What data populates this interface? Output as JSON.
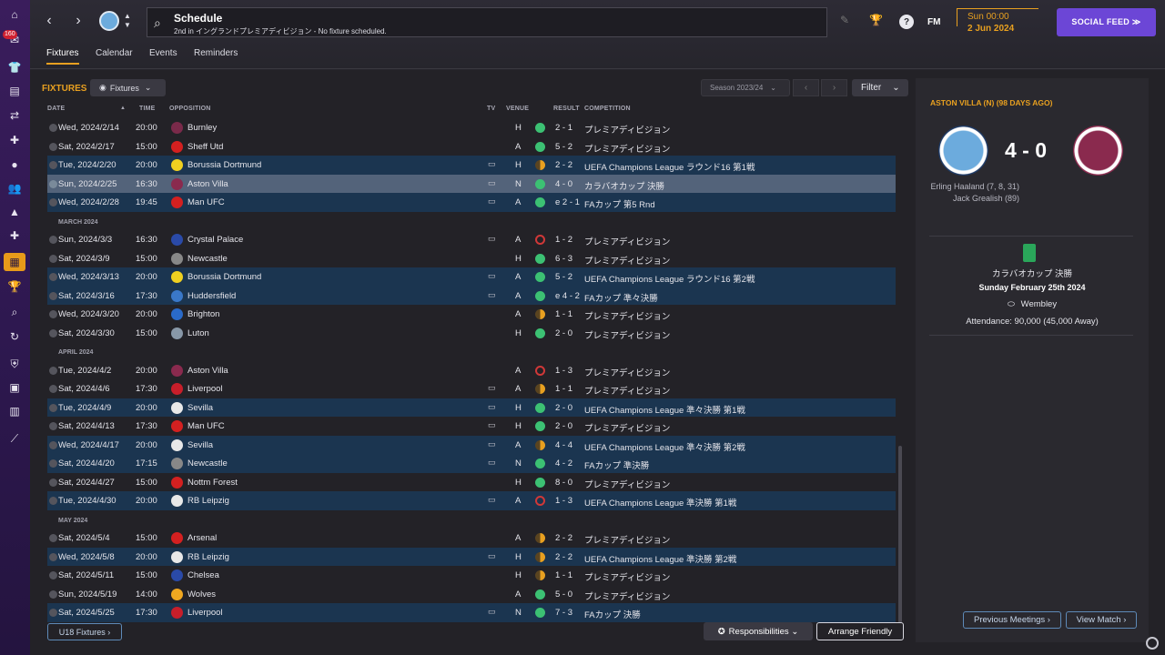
{
  "header": {
    "title": "Schedule",
    "subtitle": "2nd in イングランドプレミアディビジョン - No fixture scheduled.",
    "fm_logo": "FM",
    "time": "Sun 00:00",
    "date": "2 Jun 2024",
    "social_feed_label": "SOCIAL FEED ≫"
  },
  "sidebar": {
    "badge_count": "160",
    "icons": [
      "home-icon",
      "inbox-icon",
      "squad-icon",
      "clipboard-icon",
      "transfer-icon",
      "medical-icon",
      "ball-icon",
      "staff-icon",
      "tactics-icon",
      "training-icon",
      "schedule-icon",
      "trophy-icon",
      "search-icon",
      "refresh-icon",
      "shield-icon",
      "finance-icon",
      "ticket-icon",
      "graph-icon"
    ]
  },
  "tabs": [
    "Fixtures",
    "Calendar",
    "Events",
    "Reminders"
  ],
  "toolbar": {
    "heading": "FIXTURES",
    "fixtures_dropdown": "Fixtures",
    "season_dropdown": "Season 2023/24",
    "filter_label": "Filter"
  },
  "columns": {
    "date": "DATE",
    "time": "TIME",
    "opposition": "OPPOSITION",
    "tv": "TV",
    "venue": "VENUE",
    "result": "RESULT",
    "competition": "COMPETITION"
  },
  "colors": {
    "accent": "#e8a020",
    "win": "#3cc173",
    "loss": "#d03838",
    "draw": "#e8a020",
    "social": "#6c46d6"
  },
  "fixtures": [
    {
      "kind": "match",
      "style": "norm",
      "date": "Wed, 2024/2/14",
      "time": "20:00",
      "opp": "Burnley",
      "color": "#7a2a4a",
      "tv": "",
      "venue": "H",
      "result": "w",
      "score": "2 - 1",
      "comp": "プレミアディビジョン"
    },
    {
      "kind": "match",
      "style": "norm",
      "date": "Sat, 2024/2/17",
      "time": "15:00",
      "opp": "Sheff Utd",
      "color": "#d42020",
      "tv": "",
      "venue": "A",
      "result": "w",
      "score": "5 - 2",
      "comp": "プレミアディビジョン"
    },
    {
      "kind": "match",
      "style": "alt",
      "date": "Tue, 2024/2/20",
      "time": "20:00",
      "opp": "Borussia Dortmund",
      "color": "#f0d020",
      "tv": "▭",
      "venue": "H",
      "result": "d",
      "score": "2 - 2",
      "comp": "UEFA Champions League ラウンド16 第1戦"
    },
    {
      "kind": "match",
      "style": "sel",
      "date": "Sun, 2024/2/25",
      "time": "16:30",
      "opp": "Aston Villa",
      "color": "#8a2a4e",
      "tv": "▭",
      "venue": "N",
      "result": "w",
      "score": "4 - 0",
      "comp": "カラバオカップ 決勝"
    },
    {
      "kind": "match",
      "style": "alt",
      "date": "Wed, 2024/2/28",
      "time": "19:45",
      "opp": "Man UFC",
      "color": "#d42020",
      "tv": "▭",
      "venue": "A",
      "result": "w",
      "score": "e 2 - 1",
      "comp": "FAカップ 第5 Rnd"
    },
    {
      "kind": "month",
      "label": "MARCH 2024"
    },
    {
      "kind": "match",
      "style": "norm",
      "date": "Sun, 2024/3/3",
      "time": "16:30",
      "opp": "Crystal Palace",
      "color": "#2a4aa8",
      "tv": "▭",
      "venue": "A",
      "result": "l",
      "score": "1 - 2",
      "comp": "プレミアディビジョン"
    },
    {
      "kind": "match",
      "style": "norm",
      "date": "Sat, 2024/3/9",
      "time": "15:00",
      "opp": "Newcastle",
      "color": "#888888",
      "tv": "",
      "venue": "H",
      "result": "w",
      "score": "6 - 3",
      "comp": "プレミアディビジョン"
    },
    {
      "kind": "match",
      "style": "alt",
      "date": "Wed, 2024/3/13",
      "time": "20:00",
      "opp": "Borussia Dortmund",
      "color": "#f0d020",
      "tv": "▭",
      "venue": "A",
      "result": "w",
      "score": "5 - 2",
      "comp": "UEFA Champions League ラウンド16 第2戦"
    },
    {
      "kind": "match",
      "style": "alt",
      "date": "Sat, 2024/3/16",
      "time": "17:30",
      "opp": "Huddersfield",
      "color": "#3a78c8",
      "tv": "▭",
      "venue": "A",
      "result": "w",
      "score": "e 4 - 2",
      "comp": "FAカップ 準々決勝"
    },
    {
      "kind": "match",
      "style": "norm",
      "date": "Wed, 2024/3/20",
      "time": "20:00",
      "opp": "Brighton",
      "color": "#2a6ac8",
      "tv": "",
      "venue": "A",
      "result": "d",
      "score": "1 - 1",
      "comp": "プレミアディビジョン"
    },
    {
      "kind": "match",
      "style": "norm",
      "date": "Sat, 2024/3/30",
      "time": "15:00",
      "opp": "Luton",
      "color": "#8898a8",
      "tv": "",
      "venue": "H",
      "result": "w",
      "score": "2 - 0",
      "comp": "プレミアディビジョン"
    },
    {
      "kind": "month",
      "label": "APRIL 2024"
    },
    {
      "kind": "match",
      "style": "norm",
      "date": "Tue, 2024/4/2",
      "time": "20:00",
      "opp": "Aston Villa",
      "color": "#8a2a4e",
      "tv": "",
      "venue": "A",
      "result": "l",
      "score": "1 - 3",
      "comp": "プレミアディビジョン"
    },
    {
      "kind": "match",
      "style": "norm",
      "date": "Sat, 2024/4/6",
      "time": "17:30",
      "opp": "Liverpool",
      "color": "#c81e2a",
      "tv": "▭",
      "venue": "A",
      "result": "d",
      "score": "1 - 1",
      "comp": "プレミアディビジョン"
    },
    {
      "kind": "match",
      "style": "alt",
      "date": "Tue, 2024/4/9",
      "time": "20:00",
      "opp": "Sevilla",
      "color": "#e8e8e8",
      "tv": "▭",
      "venue": "H",
      "result": "w",
      "score": "2 - 0",
      "comp": "UEFA Champions League 準々決勝 第1戦"
    },
    {
      "kind": "match",
      "style": "norm",
      "date": "Sat, 2024/4/13",
      "time": "17:30",
      "opp": "Man UFC",
      "color": "#d42020",
      "tv": "▭",
      "venue": "H",
      "result": "w",
      "score": "2 - 0",
      "comp": "プレミアディビジョン"
    },
    {
      "kind": "match",
      "style": "alt",
      "date": "Wed, 2024/4/17",
      "time": "20:00",
      "opp": "Sevilla",
      "color": "#e8e8e8",
      "tv": "▭",
      "venue": "A",
      "result": "d",
      "score": "4 - 4",
      "comp": "UEFA Champions League 準々決勝 第2戦"
    },
    {
      "kind": "match",
      "style": "alt",
      "date": "Sat, 2024/4/20",
      "time": "17:15",
      "opp": "Newcastle",
      "color": "#888888",
      "tv": "▭",
      "venue": "N",
      "result": "w",
      "score": "4 - 2",
      "comp": "FAカップ 準決勝"
    },
    {
      "kind": "match",
      "style": "norm",
      "date": "Sat, 2024/4/27",
      "time": "15:00",
      "opp": "Nottm Forest",
      "color": "#d42020",
      "tv": "",
      "venue": "H",
      "result": "w",
      "score": "8 - 0",
      "comp": "プレミアディビジョン"
    },
    {
      "kind": "match",
      "style": "alt",
      "date": "Tue, 2024/4/30",
      "time": "20:00",
      "opp": "RB Leipzig",
      "color": "#e8e8e8",
      "tv": "▭",
      "venue": "A",
      "result": "l",
      "score": "1 - 3",
      "comp": "UEFA Champions League 準決勝 第1戦"
    },
    {
      "kind": "month",
      "label": "MAY 2024"
    },
    {
      "kind": "match",
      "style": "norm",
      "date": "Sat, 2024/5/4",
      "time": "15:00",
      "opp": "Arsenal",
      "color": "#d42020",
      "tv": "",
      "venue": "A",
      "result": "d",
      "score": "2 - 2",
      "comp": "プレミアディビジョン"
    },
    {
      "kind": "match",
      "style": "alt",
      "date": "Wed, 2024/5/8",
      "time": "20:00",
      "opp": "RB Leipzig",
      "color": "#e8e8e8",
      "tv": "▭",
      "venue": "H",
      "result": "d",
      "score": "2 - 2",
      "comp": "UEFA Champions League 準決勝 第2戦"
    },
    {
      "kind": "match",
      "style": "norm",
      "date": "Sat, 2024/5/11",
      "time": "15:00",
      "opp": "Chelsea",
      "color": "#2a4aa8",
      "tv": "",
      "venue": "H",
      "result": "d",
      "score": "1 - 1",
      "comp": "プレミアディビジョン"
    },
    {
      "kind": "match",
      "style": "norm",
      "date": "Sun, 2024/5/19",
      "time": "14:00",
      "opp": "Wolves",
      "color": "#f0a820",
      "tv": "",
      "venue": "A",
      "result": "w",
      "score": "5 - 0",
      "comp": "プレミアディビジョン"
    },
    {
      "kind": "match",
      "style": "alt",
      "date": "Sat, 2024/5/25",
      "time": "17:30",
      "opp": "Liverpool",
      "color": "#c81e2a",
      "tv": "▭",
      "venue": "N",
      "result": "w",
      "score": "7 - 3",
      "comp": "FAカップ 決勝"
    }
  ],
  "footer": {
    "u18_label": "U18 Fixtures ›",
    "responsibilities_label": "Responsibilities ⌄",
    "arrange_label": "Arrange Friendly"
  },
  "match_panel": {
    "title": "ASTON VILLA (N) (98 DAYS AGO)",
    "score": "4 - 0",
    "scorer_1": "Erling Haaland (7, 8, 31)",
    "scorer_2": "Jack Grealish (89)",
    "competition": "カラバオカップ 決勝",
    "date": "Sunday February 25th 2024",
    "venue": "Wembley",
    "attendance": "Attendance: 90,000 (45,000 Away)",
    "previous_label": "Previous Meetings ›",
    "view_label": "View Match ›"
  }
}
